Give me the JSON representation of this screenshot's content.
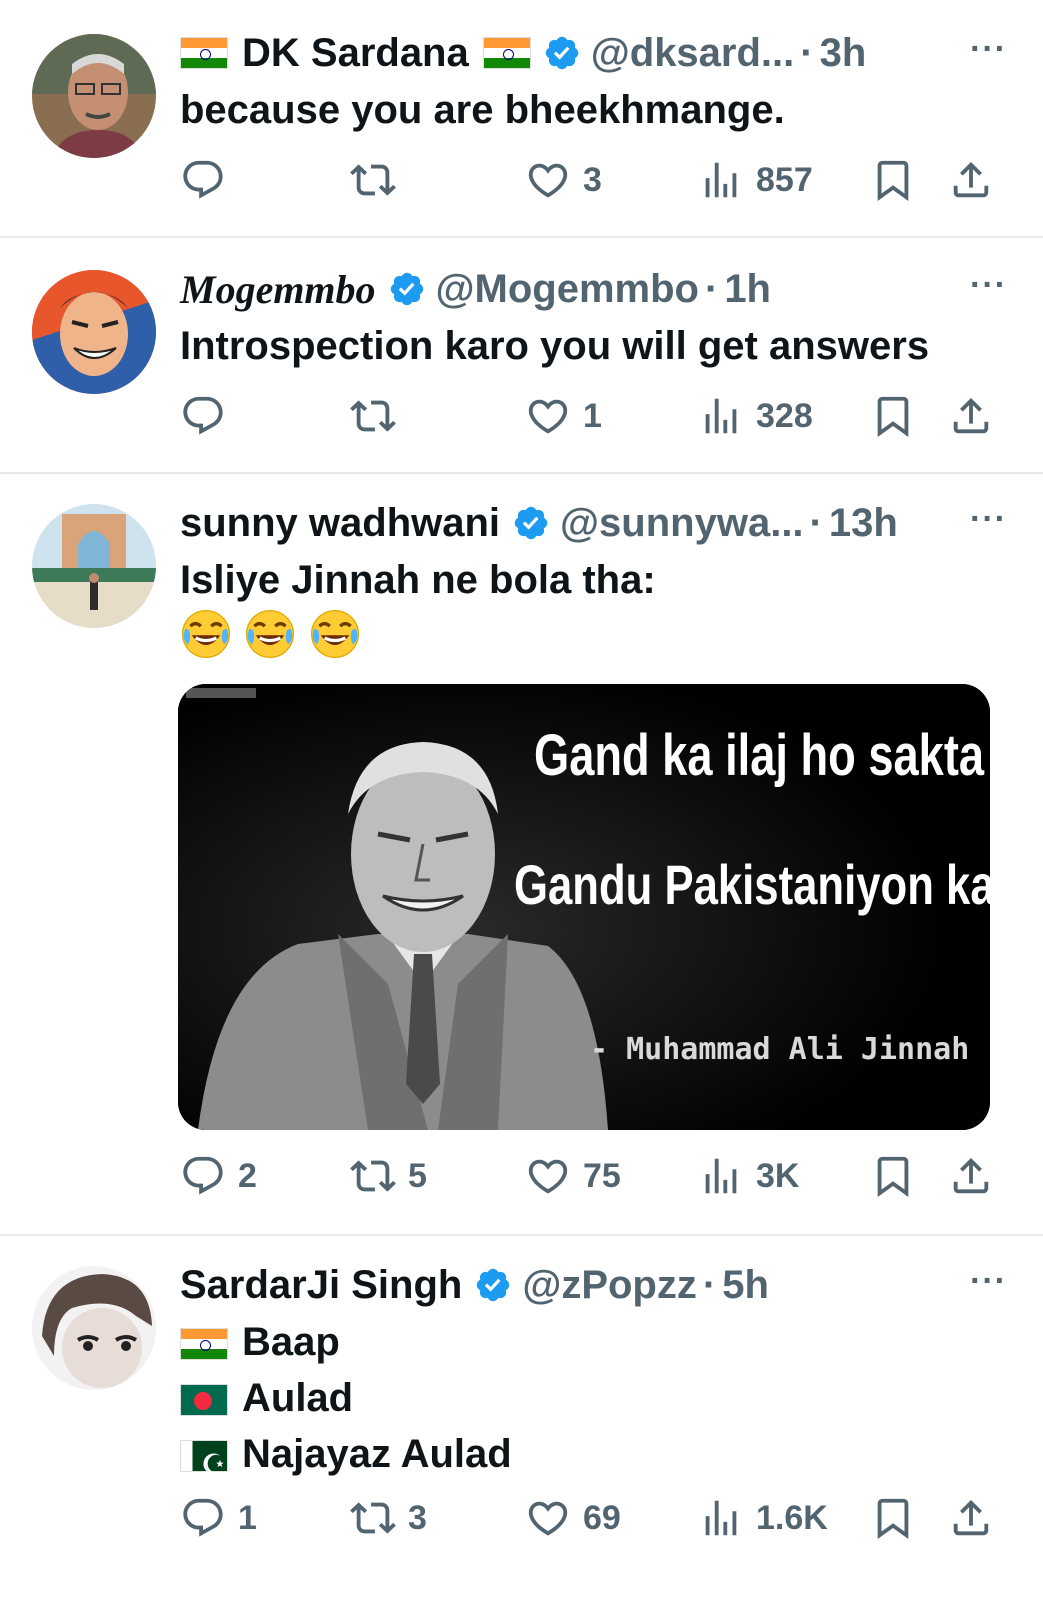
{
  "tweets": [
    {
      "name": "DK Sardana",
      "name_flags": [
        "india",
        "india"
      ],
      "verified": true,
      "handle": "@dksard...",
      "time": "3h",
      "text": "because you are bheekhmange.",
      "actions": {
        "replies": "",
        "retweets": "",
        "likes": "3",
        "views": "857"
      }
    },
    {
      "name": "Mogemmbo",
      "verified": true,
      "handle": "@Mogemmbo",
      "time": "1h",
      "text": "Introspection karo you will get answers",
      "actions": {
        "replies": "",
        "retweets": "",
        "likes": "1",
        "views": "328"
      }
    },
    {
      "name": "sunny wadhwani",
      "verified": true,
      "handle": "@sunnywa...",
      "time": "13h",
      "text": "Isliye Jinnah ne bola tha:",
      "emoji": [
        "face-with-tears-of-joy",
        "face-with-tears-of-joy",
        "face-with-tears-of-joy"
      ],
      "media": {
        "line1": "Gand ka ilaj ho sakta hai.",
        "line2": "Gandu Pakistaniyon ka nahi",
        "attribution": "- Muhammad Ali Jinnah"
      },
      "actions": {
        "replies": "2",
        "retweets": "5",
        "likes": "75",
        "views": "3K"
      }
    },
    {
      "name": "SardarJi Singh",
      "verified": true,
      "handle": "@zPopzz",
      "time": "5h",
      "lines": [
        {
          "flag": "india",
          "text": "Baap"
        },
        {
          "flag": "bangladesh",
          "text": "Aulad"
        },
        {
          "flag": "pakistan",
          "text": "Najayaz Aulad"
        }
      ],
      "actions": {
        "replies": "1",
        "retweets": "3",
        "likes": "69",
        "views": "1.6K"
      }
    }
  ],
  "separator": "·",
  "more_label": "···",
  "colors": {
    "verified": "#1d9bf0",
    "text": "#0f1419",
    "muted": "#536471",
    "divider": "#e7e9ea"
  }
}
